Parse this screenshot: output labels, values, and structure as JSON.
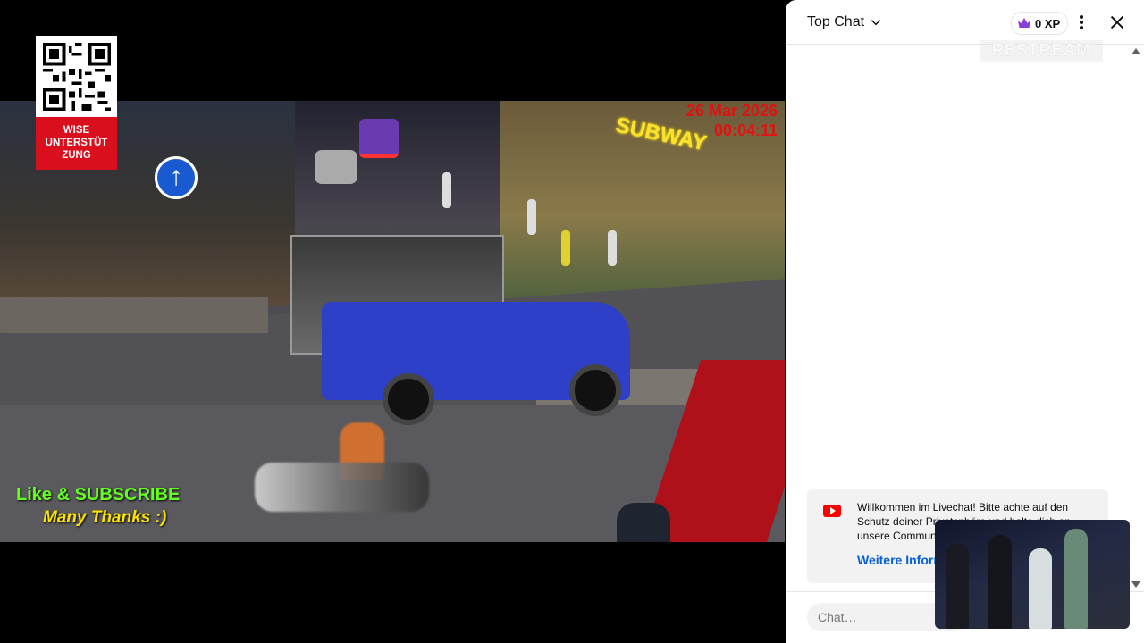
{
  "video": {
    "timestamp_date": "26 Mar 2026",
    "timestamp_time": "00:04:11",
    "overlay_like": "Like & SUBSCRIBE",
    "overlay_thanks": "Many Thanks :)",
    "donation_label": "WISE\nUNTERSTÜT\nZUNG",
    "sign_text": "SUBWAY",
    "colors": {
      "like": "#66ff22",
      "thanks": "#ffe400",
      "stamp": "#e41010",
      "donation_bg": "#d90f1d"
    }
  },
  "chat": {
    "title": "Top Chat",
    "xp": "0 XP",
    "watermark": "RESTREAM",
    "welcome_message": "Willkommen im Livechat! Bitte achte auf den Schutz deiner Privatsphäre und halte dich an unsere Community-Richtlinien.",
    "welcome_link": "Weitere Informationen",
    "input_placeholder": "Chat…",
    "icons": [
      "chevron-down-icon",
      "crown-icon",
      "more-vert-icon",
      "close-icon",
      "youtube-icon"
    ]
  }
}
